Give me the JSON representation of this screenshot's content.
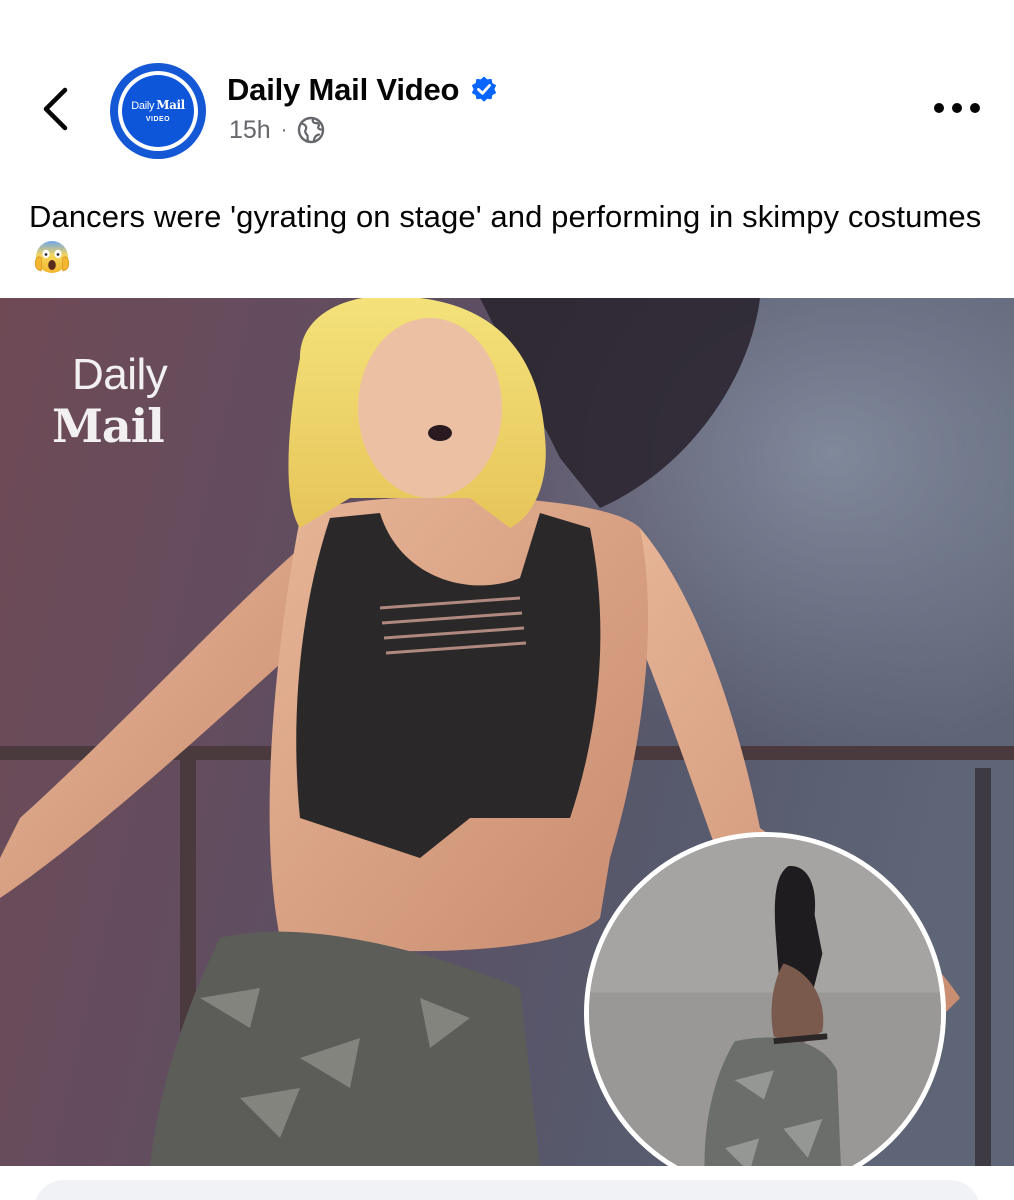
{
  "header": {
    "back_icon": "chevron-left-icon",
    "page_name": "Daily Mail Video",
    "verified_icon": "verified-badge-icon",
    "time_ago": "15h",
    "separator": "·",
    "audience_icon": "globe-icon",
    "more_icon": "more-horizontal-icon",
    "avatar": {
      "logo_word1": "Daily",
      "logo_word2": "Mail",
      "logo_sub": "VIDEO"
    }
  },
  "post": {
    "caption": "Dancers were 'gyrating on stage' and performing in skimpy costumes",
    "emoji_icon": "face-screaming-in-fear-icon"
  },
  "media": {
    "watermark_line1": "Daily",
    "watermark_line2": "Mail"
  },
  "colors": {
    "accent_blue": "#0866ff",
    "avatar_blue": "#1458d6",
    "text_primary": "#050505",
    "text_secondary": "#65676b"
  }
}
